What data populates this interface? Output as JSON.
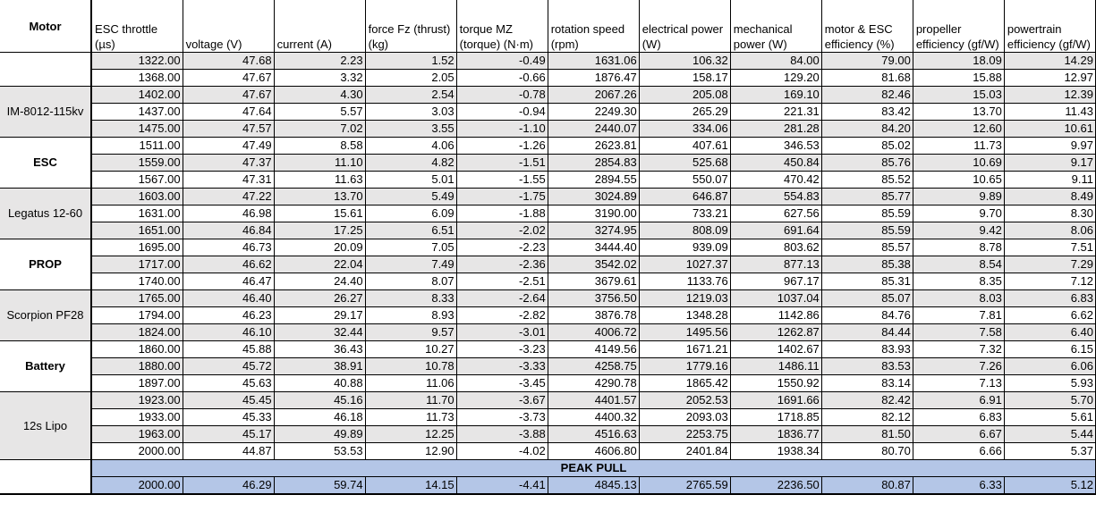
{
  "headers": [
    "Motor",
    "ESC throttle (µs)",
    "voltage (V)",
    "current (A)",
    "force Fz (thrust) (kg)",
    "torque MZ (torque) (N·m)",
    "rotation speed (rpm)",
    "electrical power (W)",
    "mechanical power (W)",
    "motor & ESC efficiency (%)",
    "propeller efficiency (gf/W)",
    "powertrain efficiency (gf/W)"
  ],
  "groups": [
    {
      "label": "Motor",
      "bold": true,
      "shade": false
    },
    {
      "label": "IM-8012-115kv",
      "bold": false,
      "shade": true
    },
    {
      "label": "ESC",
      "bold": true,
      "shade": false
    },
    {
      "label": "Legatus 12-60",
      "bold": false,
      "shade": true
    },
    {
      "label": "PROP",
      "bold": true,
      "shade": false
    },
    {
      "label": "Scorpion PF28",
      "bold": false,
      "shade": true
    },
    {
      "label": "Battery",
      "bold": true,
      "shade": false
    },
    {
      "label": "12s Lipo",
      "bold": false,
      "shade": true
    }
  ],
  "rows": [
    [
      "1322.00",
      "47.68",
      "2.23",
      "1.52",
      "-0.49",
      "1631.06",
      "106.32",
      "84.00",
      "79.00",
      "18.09",
      "14.29"
    ],
    [
      "1368.00",
      "47.67",
      "3.32",
      "2.05",
      "-0.66",
      "1876.47",
      "158.17",
      "129.20",
      "81.68",
      "15.88",
      "12.97"
    ],
    [
      "1402.00",
      "47.67",
      "4.30",
      "2.54",
      "-0.78",
      "2067.26",
      "205.08",
      "169.10",
      "82.46",
      "15.03",
      "12.39"
    ],
    [
      "1437.00",
      "47.64",
      "5.57",
      "3.03",
      "-0.94",
      "2249.30",
      "265.29",
      "221.31",
      "83.42",
      "13.70",
      "11.43"
    ],
    [
      "1475.00",
      "47.57",
      "7.02",
      "3.55",
      "-1.10",
      "2440.07",
      "334.06",
      "281.28",
      "84.20",
      "12.60",
      "10.61"
    ],
    [
      "1511.00",
      "47.49",
      "8.58",
      "4.06",
      "-1.26",
      "2623.81",
      "407.61",
      "346.53",
      "85.02",
      "11.73",
      "9.97"
    ],
    [
      "1559.00",
      "47.37",
      "11.10",
      "4.82",
      "-1.51",
      "2854.83",
      "525.68",
      "450.84",
      "85.76",
      "10.69",
      "9.17"
    ],
    [
      "1567.00",
      "47.31",
      "11.63",
      "5.01",
      "-1.55",
      "2894.55",
      "550.07",
      "470.42",
      "85.52",
      "10.65",
      "9.11"
    ],
    [
      "1603.00",
      "47.22",
      "13.70",
      "5.49",
      "-1.75",
      "3024.89",
      "646.87",
      "554.83",
      "85.77",
      "9.89",
      "8.49"
    ],
    [
      "1631.00",
      "46.98",
      "15.61",
      "6.09",
      "-1.88",
      "3190.00",
      "733.21",
      "627.56",
      "85.59",
      "9.70",
      "8.30"
    ],
    [
      "1651.00",
      "46.84",
      "17.25",
      "6.51",
      "-2.02",
      "3274.95",
      "808.09",
      "691.64",
      "85.59",
      "9.42",
      "8.06"
    ],
    [
      "1695.00",
      "46.73",
      "20.09",
      "7.05",
      "-2.23",
      "3444.40",
      "939.09",
      "803.62",
      "85.57",
      "8.78",
      "7.51"
    ],
    [
      "1717.00",
      "46.62",
      "22.04",
      "7.49",
      "-2.36",
      "3542.02",
      "1027.37",
      "877.13",
      "85.38",
      "8.54",
      "7.29"
    ],
    [
      "1740.00",
      "46.47",
      "24.40",
      "8.07",
      "-2.51",
      "3679.61",
      "1133.76",
      "967.17",
      "85.31",
      "8.35",
      "7.12"
    ],
    [
      "1765.00",
      "46.40",
      "26.27",
      "8.33",
      "-2.64",
      "3756.50",
      "1219.03",
      "1037.04",
      "85.07",
      "8.03",
      "6.83"
    ],
    [
      "1794.00",
      "46.23",
      "29.17",
      "8.93",
      "-2.82",
      "3876.78",
      "1348.28",
      "1142.86",
      "84.76",
      "7.81",
      "6.62"
    ],
    [
      "1824.00",
      "46.10",
      "32.44",
      "9.57",
      "-3.01",
      "4006.72",
      "1495.56",
      "1262.87",
      "84.44",
      "7.58",
      "6.40"
    ],
    [
      "1860.00",
      "45.88",
      "36.43",
      "10.27",
      "-3.23",
      "4149.56",
      "1671.21",
      "1402.67",
      "83.93",
      "7.32",
      "6.15"
    ],
    [
      "1880.00",
      "45.72",
      "38.91",
      "10.78",
      "-3.33",
      "4258.75",
      "1779.16",
      "1486.11",
      "83.53",
      "7.26",
      "6.06"
    ],
    [
      "1897.00",
      "45.63",
      "40.88",
      "11.06",
      "-3.45",
      "4290.78",
      "1865.42",
      "1550.92",
      "83.14",
      "7.13",
      "5.93"
    ],
    [
      "1923.00",
      "45.45",
      "45.16",
      "11.70",
      "-3.67",
      "4401.57",
      "2052.53",
      "1691.66",
      "82.42",
      "6.91",
      "5.70"
    ],
    [
      "1933.00",
      "45.33",
      "46.18",
      "11.73",
      "-3.73",
      "4400.32",
      "2093.03",
      "1718.85",
      "82.12",
      "6.83",
      "5.61"
    ],
    [
      "1963.00",
      "45.17",
      "49.89",
      "12.25",
      "-3.88",
      "4516.63",
      "2253.75",
      "1836.77",
      "81.50",
      "6.67",
      "5.44"
    ],
    [
      "2000.00",
      "44.87",
      "53.53",
      "12.90",
      "-4.02",
      "4606.80",
      "2401.84",
      "1938.34",
      "80.70",
      "6.66",
      "5.37"
    ]
  ],
  "peak": {
    "title": "PEAK PULL",
    "values": [
      "2000.00",
      "46.29",
      "59.74",
      "14.15",
      "-4.41",
      "4845.13",
      "2765.59",
      "2236.50",
      "80.87",
      "6.33",
      "5.12"
    ]
  },
  "colors": {
    "row_shade": "#e7e6e6",
    "peak_fill": "#b4c6e7",
    "grid": "#000000"
  }
}
